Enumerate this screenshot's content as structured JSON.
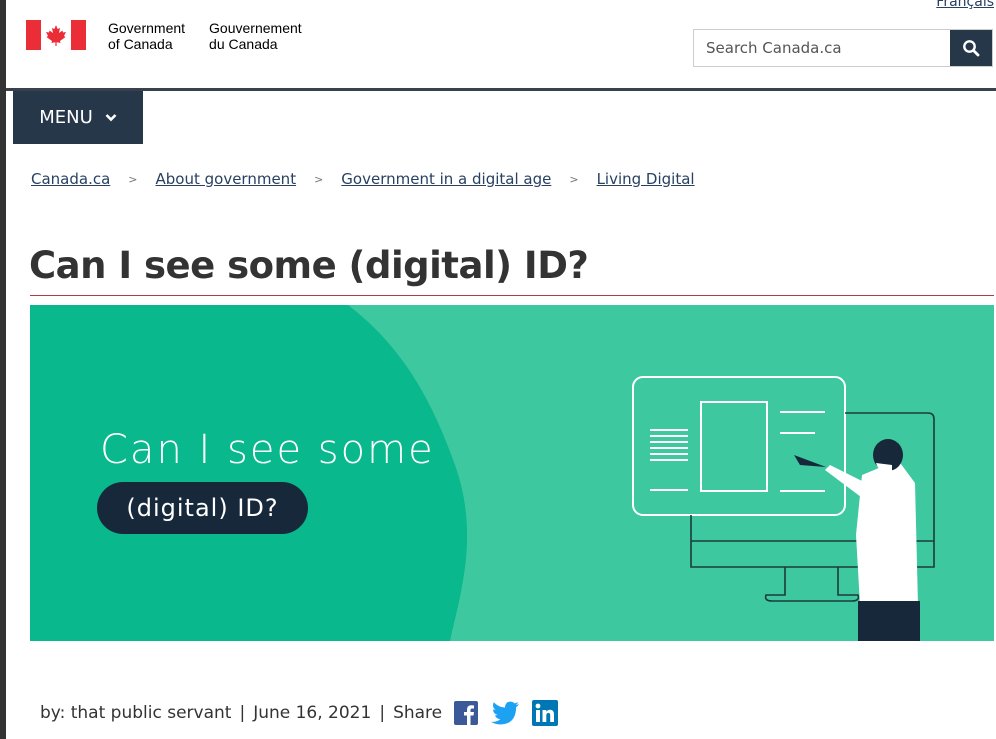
{
  "header": {
    "language_link": "Français",
    "government_en_line1": "Government",
    "government_en_line2": "of Canada",
    "government_fr_line1": "Gouvernement",
    "government_fr_line2": "du Canada",
    "search_placeholder": "Search Canada.ca",
    "flag_icon": "canada-flag-icon",
    "search_icon": "search-icon"
  },
  "menu": {
    "label": "MENU",
    "icon": "chevron-down-icon"
  },
  "breadcrumb": [
    "Canada.ca",
    "About government",
    "Government in a digital age",
    "Living Digital"
  ],
  "page": {
    "title": "Can I see some (digital) ID?"
  },
  "hero": {
    "line1": "Can I see some",
    "line2": "(digital) ID?",
    "colors": {
      "background": "#3ec8a0",
      "dark_panel": "#09b88c",
      "pill": "#16283a"
    }
  },
  "byline": {
    "author": "by: that public servant",
    "date": "June 16, 2021",
    "share_label": "Share",
    "share_icons": [
      "facebook-icon",
      "twitter-icon",
      "linkedin-icon"
    ]
  }
}
